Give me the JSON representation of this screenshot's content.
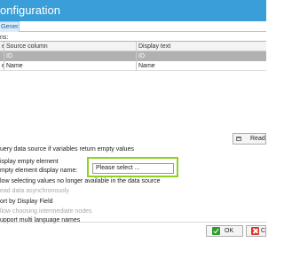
{
  "window": {
    "title": "onfiguration"
  },
  "tabs": [
    {
      "label": "General",
      "active": true
    }
  ],
  "columns_section": {
    "label": "ns:"
  },
  "grid": {
    "headers": [
      "e",
      "Source column",
      "Display text"
    ],
    "rows": [
      {
        "cells": [
          "",
          "ID",
          "ID"
        ],
        "selected": true
      },
      {
        "cells": [
          "e",
          "Name",
          "Name"
        ],
        "selected": false
      }
    ]
  },
  "read_button": {
    "label": "Read"
  },
  "options": {
    "query_empty": "uery data source if variables return empty values",
    "display_empty": "isplay empty element",
    "empty_display_name_label": "mpty element display name:",
    "empty_display_name_value": "Please select ...",
    "allow_selecting_unavailable": "low selecting values no longer available in the data source",
    "read_async": "ead data asynchronously",
    "sort_by_display": "ort by Display Field",
    "allow_intermediate": "llow choosing intermediate nodes",
    "multi_language": "upport multi language names"
  },
  "footer": {
    "ok_label": "OK",
    "cancel_label": "Ca"
  },
  "colors": {
    "titlebar": "#3a9fd8",
    "highlight": "#8ed11f",
    "ok_icon": "#2f9a32",
    "cancel_icon": "#d9342b"
  }
}
